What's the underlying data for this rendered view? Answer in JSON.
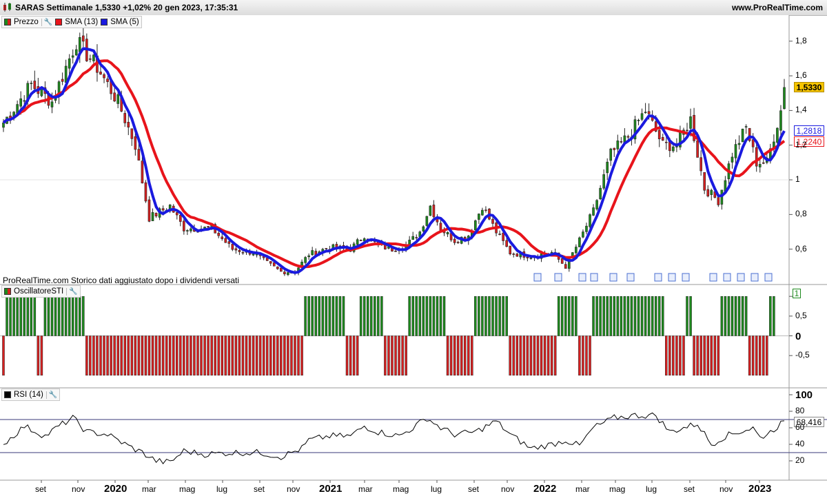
{
  "window": {
    "title": "SARAS Settimanale 1,5330 +1,02% 20 gen 2023, 17:35:31",
    "site": "www.ProRealTime.com"
  },
  "panels": {
    "price": {
      "legend": [
        {
          "label": "Prezzo",
          "color": "#1e8a1e"
        },
        {
          "label": "SMA (13)",
          "color": "#e8141b"
        },
        {
          "label": "SMA (5)",
          "color": "#1a1adf"
        }
      ],
      "note": "ProRealTime.com  Storico dati aggiustato dopo i dividendi versati",
      "yticks": [
        "1,8",
        "1,6",
        "1,4",
        "1,2",
        "1",
        "0,8",
        "0,6"
      ],
      "tags": [
        {
          "label": "1,5330",
          "value": 1.533,
          "bg": "#f5c400",
          "fg": "#000000"
        },
        {
          "label": "1,2818",
          "value": 1.2818,
          "bg": "#ffffff",
          "fg": "#1a1adf"
        },
        {
          "label": "1,2240",
          "value": 1.224,
          "bg": "#ffffff",
          "fg": "#e8141b"
        }
      ]
    },
    "sti": {
      "legend": [
        {
          "label": "OscillatoreSTI",
          "color": "#1e8a1e"
        }
      ],
      "yticks": [
        "1",
        "0,5",
        "0",
        "-0,5"
      ],
      "tag": "1"
    },
    "rsi": {
      "legend": [
        {
          "label": "RSI (14)",
          "color": "#000000"
        }
      ],
      "yticks": [
        "100",
        "80",
        "60",
        "40",
        "20"
      ],
      "tag": "68,416",
      "levels": [
        70,
        30
      ]
    }
  },
  "xaxis": [
    {
      "label": "set",
      "bold": false
    },
    {
      "label": "nov",
      "bold": false
    },
    {
      "label": "2020",
      "bold": true
    },
    {
      "label": "mar",
      "bold": false
    },
    {
      "label": "mag",
      "bold": false
    },
    {
      "label": "lug",
      "bold": false
    },
    {
      "label": "set",
      "bold": false
    },
    {
      "label": "nov",
      "bold": false
    },
    {
      "label": "2021",
      "bold": true
    },
    {
      "label": "mar",
      "bold": false
    },
    {
      "label": "mag",
      "bold": false
    },
    {
      "label": "lug",
      "bold": false
    },
    {
      "label": "set",
      "bold": false
    },
    {
      "label": "nov",
      "bold": false
    },
    {
      "label": "2022",
      "bold": true
    },
    {
      "label": "mar",
      "bold": false
    },
    {
      "label": "mag",
      "bold": false
    },
    {
      "label": "lug",
      "bold": false
    },
    {
      "label": "set",
      "bold": false
    },
    {
      "label": "nov",
      "bold": false
    },
    {
      "label": "2023",
      "bold": true
    }
  ],
  "chart_data": {
    "type": "candlestick",
    "title": "SARAS Settimanale",
    "period": "weekly",
    "last": {
      "close": 1.533,
      "change": "+1,02%",
      "date": "20 gen 2023"
    },
    "x_range": [
      "2019-07",
      "2023-01"
    ],
    "price_ylim": [
      0.4,
      1.95
    ],
    "price_keyframes": [
      [
        0,
        1.33
      ],
      [
        8,
        1.55
      ],
      [
        14,
        1.45
      ],
      [
        21,
        1.8
      ],
      [
        27,
        1.65
      ],
      [
        33,
        1.45
      ],
      [
        38,
        1.2
      ],
      [
        42,
        0.78
      ],
      [
        48,
        0.85
      ],
      [
        52,
        0.72
      ],
      [
        60,
        0.72
      ],
      [
        66,
        0.6
      ],
      [
        72,
        0.58
      ],
      [
        76,
        0.52
      ],
      [
        80,
        0.47
      ],
      [
        84,
        0.47
      ],
      [
        88,
        0.57
      ],
      [
        94,
        0.61
      ],
      [
        100,
        0.6
      ],
      [
        104,
        0.68
      ],
      [
        108,
        0.62
      ],
      [
        112,
        0.6
      ],
      [
        116,
        0.62
      ],
      [
        120,
        0.7
      ],
      [
        123,
        0.85
      ],
      [
        126,
        0.72
      ],
      [
        130,
        0.65
      ],
      [
        134,
        0.68
      ],
      [
        138,
        0.85
      ],
      [
        142,
        0.7
      ],
      [
        146,
        0.58
      ],
      [
        152,
        0.56
      ],
      [
        158,
        0.58
      ],
      [
        162,
        0.5
      ],
      [
        166,
        0.65
      ],
      [
        170,
        0.82
      ],
      [
        175,
        1.15
      ],
      [
        180,
        1.25
      ],
      [
        185,
        1.4
      ],
      [
        190,
        1.2
      ],
      [
        194,
        1.2
      ],
      [
        198,
        1.35
      ],
      [
        202,
        0.95
      ],
      [
        206,
        0.88
      ],
      [
        210,
        1.15
      ],
      [
        214,
        1.3
      ],
      [
        217,
        1.1
      ],
      [
        220,
        1.1
      ],
      [
        222,
        1.25
      ],
      [
        224,
        1.4
      ],
      [
        225,
        1.53
      ]
    ],
    "sma13_last": 1.224,
    "sma5_last": 1.2818,
    "sti_segments": [
      {
        "from": 0,
        "to": 0,
        "value": -1
      },
      {
        "from": 1,
        "to": 9,
        "value": 1
      },
      {
        "from": 10,
        "to": 11,
        "value": -1
      },
      {
        "from": 12,
        "to": 23,
        "value": 1
      },
      {
        "from": 24,
        "to": 86,
        "value": -1
      },
      {
        "from": 87,
        "to": 98,
        "value": 1
      },
      {
        "from": 99,
        "to": 102,
        "value": -1
      },
      {
        "from": 103,
        "to": 109,
        "value": 1
      },
      {
        "from": 110,
        "to": 116,
        "value": -1
      },
      {
        "from": 117,
        "to": 127,
        "value": 1
      },
      {
        "from": 128,
        "to": 135,
        "value": -1
      },
      {
        "from": 136,
        "to": 145,
        "value": 1
      },
      {
        "from": 146,
        "to": 159,
        "value": -1
      },
      {
        "from": 160,
        "to": 165,
        "value": 1
      },
      {
        "from": 166,
        "to": 169,
        "value": -1
      },
      {
        "from": 170,
        "to": 190,
        "value": 1
      },
      {
        "from": 191,
        "to": 196,
        "value": -1
      },
      {
        "from": 197,
        "to": 198,
        "value": 1
      },
      {
        "from": 199,
        "to": 206,
        "value": -1
      },
      {
        "from": 207,
        "to": 214,
        "value": 1
      },
      {
        "from": 215,
        "to": 220,
        "value": -1
      },
      {
        "from": 221,
        "to": 222,
        "value": 1
      }
    ],
    "sti_ylim": [
      -1.3,
      1.3
    ],
    "rsi_keyframes": [
      [
        0,
        40
      ],
      [
        6,
        62
      ],
      [
        12,
        50
      ],
      [
        16,
        62
      ],
      [
        20,
        72
      ],
      [
        24,
        55
      ],
      [
        30,
        52
      ],
      [
        36,
        38
      ],
      [
        40,
        30
      ],
      [
        44,
        20
      ],
      [
        48,
        18
      ],
      [
        52,
        32
      ],
      [
        58,
        28
      ],
      [
        66,
        30
      ],
      [
        74,
        30
      ],
      [
        80,
        25
      ],
      [
        86,
        35
      ],
      [
        88,
        45
      ],
      [
        94,
        50
      ],
      [
        100,
        50
      ],
      [
        104,
        62
      ],
      [
        108,
        55
      ],
      [
        114,
        50
      ],
      [
        118,
        60
      ],
      [
        122,
        72
      ],
      [
        126,
        60
      ],
      [
        130,
        52
      ],
      [
        136,
        55
      ],
      [
        142,
        68
      ],
      [
        146,
        52
      ],
      [
        152,
        35
      ],
      [
        158,
        40
      ],
      [
        162,
        45
      ],
      [
        166,
        38
      ],
      [
        170,
        60
      ],
      [
        176,
        72
      ],
      [
        182,
        75
      ],
      [
        188,
        75
      ],
      [
        192,
        55
      ],
      [
        196,
        60
      ],
      [
        200,
        65
      ],
      [
        204,
        40
      ],
      [
        208,
        50
      ],
      [
        212,
        55
      ],
      [
        216,
        60
      ],
      [
        218,
        48
      ],
      [
        221,
        55
      ],
      [
        225,
        68.4
      ]
    ],
    "rsi_ylim": [
      0,
      100
    ],
    "rsi_levels": [
      70,
      30
    ]
  }
}
